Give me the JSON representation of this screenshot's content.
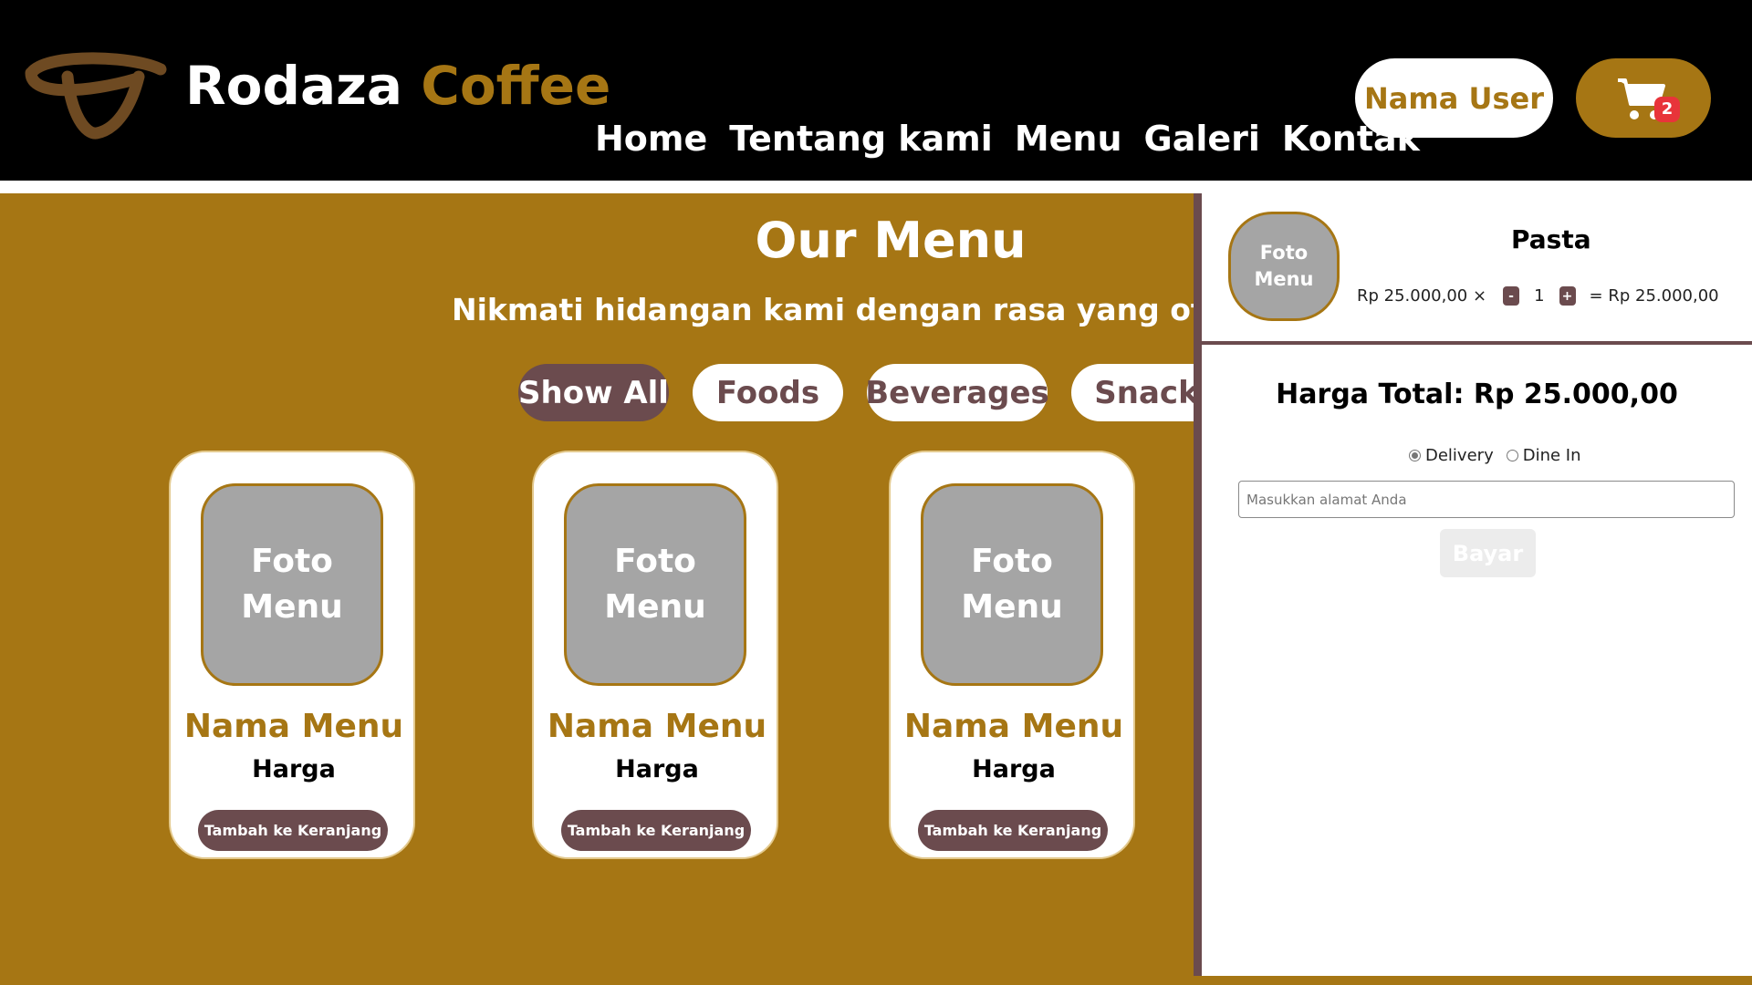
{
  "header": {
    "brand_name": "Rodaza",
    "brand_accent": "Coffee",
    "logo_icon": "coffee-bean-swirl-icon",
    "nav": [
      {
        "label": "Home"
      },
      {
        "label": "Tentang kami"
      },
      {
        "label": "Menu"
      },
      {
        "label": "Galeri"
      },
      {
        "label": "Kontak"
      }
    ],
    "user_label": "Nama User",
    "cart_icon": "shopping-cart-icon",
    "cart_count": "2"
  },
  "menu": {
    "title": "Our Menu",
    "subtitle": "Nikmati hidangan kami dengan rasa yang otentik d",
    "filters": [
      {
        "label": "Show All",
        "active": true
      },
      {
        "label": "Foods"
      },
      {
        "label": "Beverages"
      },
      {
        "label": "Snack"
      }
    ],
    "cards": [
      {
        "photo_label": "Foto Menu",
        "name": "Nama Menu",
        "price": "Harga",
        "button": "Tambah ke Keranjang"
      },
      {
        "photo_label": "Foto Menu",
        "name": "Nama Menu",
        "price": "Harga",
        "button": "Tambah ke Keranjang"
      },
      {
        "photo_label": "Foto Menu",
        "name": "Nama Menu",
        "price": "Harga",
        "button": "Tambah ke Keranjang"
      }
    ]
  },
  "cart": {
    "item": {
      "photo_label": "Foto Menu",
      "name": "Pasta",
      "unit_price": "Rp 25.000,00 ×",
      "minus": "-",
      "quantity": "1",
      "plus": "+",
      "subtotal": "= Rp 25.000,00"
    },
    "total": "Harga Total: Rp 25.000,00",
    "options": [
      {
        "label": "Delivery",
        "checked": true
      },
      {
        "label": "Dine In",
        "checked": false
      }
    ],
    "address_placeholder": "Masukkan alamat Anda",
    "pay_label": "Bayar"
  },
  "colors": {
    "brand_gold": "#a67614",
    "brown": "#6b4b4e",
    "header_bg": "#000000",
    "badge_red": "#e8343a"
  }
}
